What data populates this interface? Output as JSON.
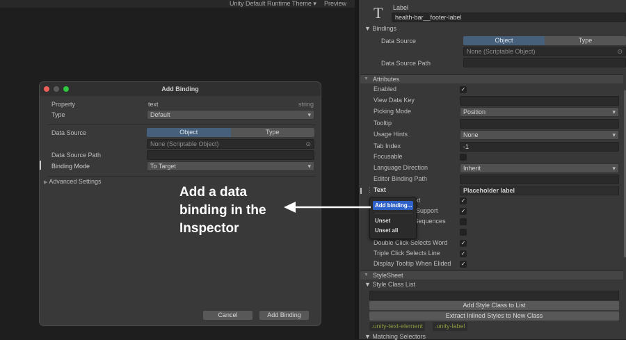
{
  "toolbar": {
    "theme": "Unity Default Runtime Theme",
    "preview": "Preview"
  },
  "inspector": {
    "element_type": "Label",
    "element_name": "health-bar__footer-label",
    "bindings": {
      "header": "Bindings",
      "data_source_label": "Data Source",
      "seg_object": "Object",
      "seg_type": "Type",
      "data_source_value": "None (Scriptable Object)",
      "data_source_path_label": "Data Source Path"
    },
    "attributes_header": "Attributes",
    "rows": [
      {
        "label": "Enabled",
        "kind": "check",
        "checked": true
      },
      {
        "label": "View Data Key",
        "kind": "text",
        "value": ""
      },
      {
        "label": "Picking Mode",
        "kind": "drop",
        "value": "Position"
      },
      {
        "label": "Tooltip",
        "kind": "text",
        "value": ""
      },
      {
        "label": "Usage Hints",
        "kind": "drop",
        "value": "None"
      },
      {
        "label": "Tab Index",
        "kind": "text",
        "value": "-1"
      },
      {
        "label": "Focusable",
        "kind": "check",
        "checked": false
      },
      {
        "label": "Language Direction",
        "kind": "drop",
        "value": "Inherit"
      },
      {
        "label": "Editor Binding Path",
        "kind": "text",
        "value": ""
      },
      {
        "label": "Text",
        "kind": "text",
        "value": "Placeholder label",
        "bold": true
      },
      {
        "label": "Enable Rich Text",
        "kind": "check",
        "checked": true
      },
      {
        "label": "Emoji Fallback Support",
        "kind": "check",
        "checked": true
      },
      {
        "label": "Parse Escape Sequences",
        "kind": "check",
        "checked": false
      },
      {
        "label": "",
        "kind": "check",
        "checked": false
      },
      {
        "label": "Double Click Selects Word",
        "kind": "check",
        "checked": true
      },
      {
        "label": "Triple Click Selects Line",
        "kind": "check",
        "checked": true
      },
      {
        "label": "Display Tooltip When Elided",
        "kind": "check",
        "checked": true
      }
    ],
    "stylesheet_header": "StyleSheet",
    "style_class_list": "Style Class List",
    "add_style_class": "Add Style Class to List",
    "extract_styles": "Extract Inlined Styles to New Class",
    "classes": [
      ".unity-text-element",
      ".unity-label"
    ],
    "matching_selectors": "Matching Selectors"
  },
  "context_menu": {
    "add_binding": "Add binding...",
    "unset": "Unset",
    "unset_all": "Unset all"
  },
  "callout": "Add a data binding in the Inspector",
  "dialog": {
    "title": "Add Binding",
    "property_label": "Property",
    "property_value": "text",
    "property_type": "string",
    "type_label": "Type",
    "type_value": "Default",
    "data_source_label": "Data Source",
    "seg_object": "Object",
    "seg_type": "Type",
    "data_source_value": "None (Scriptable Object)",
    "data_source_path_label": "Data Source Path",
    "binding_mode_label": "Binding Mode",
    "binding_mode_value": "To Target",
    "advanced": "Advanced Settings",
    "cancel": "Cancel",
    "add": "Add Binding"
  },
  "colors": {
    "accent": "#46607c",
    "menu_highlight": "#2f62c9",
    "close": "#ec5f57",
    "zoom": "#2bc840"
  }
}
